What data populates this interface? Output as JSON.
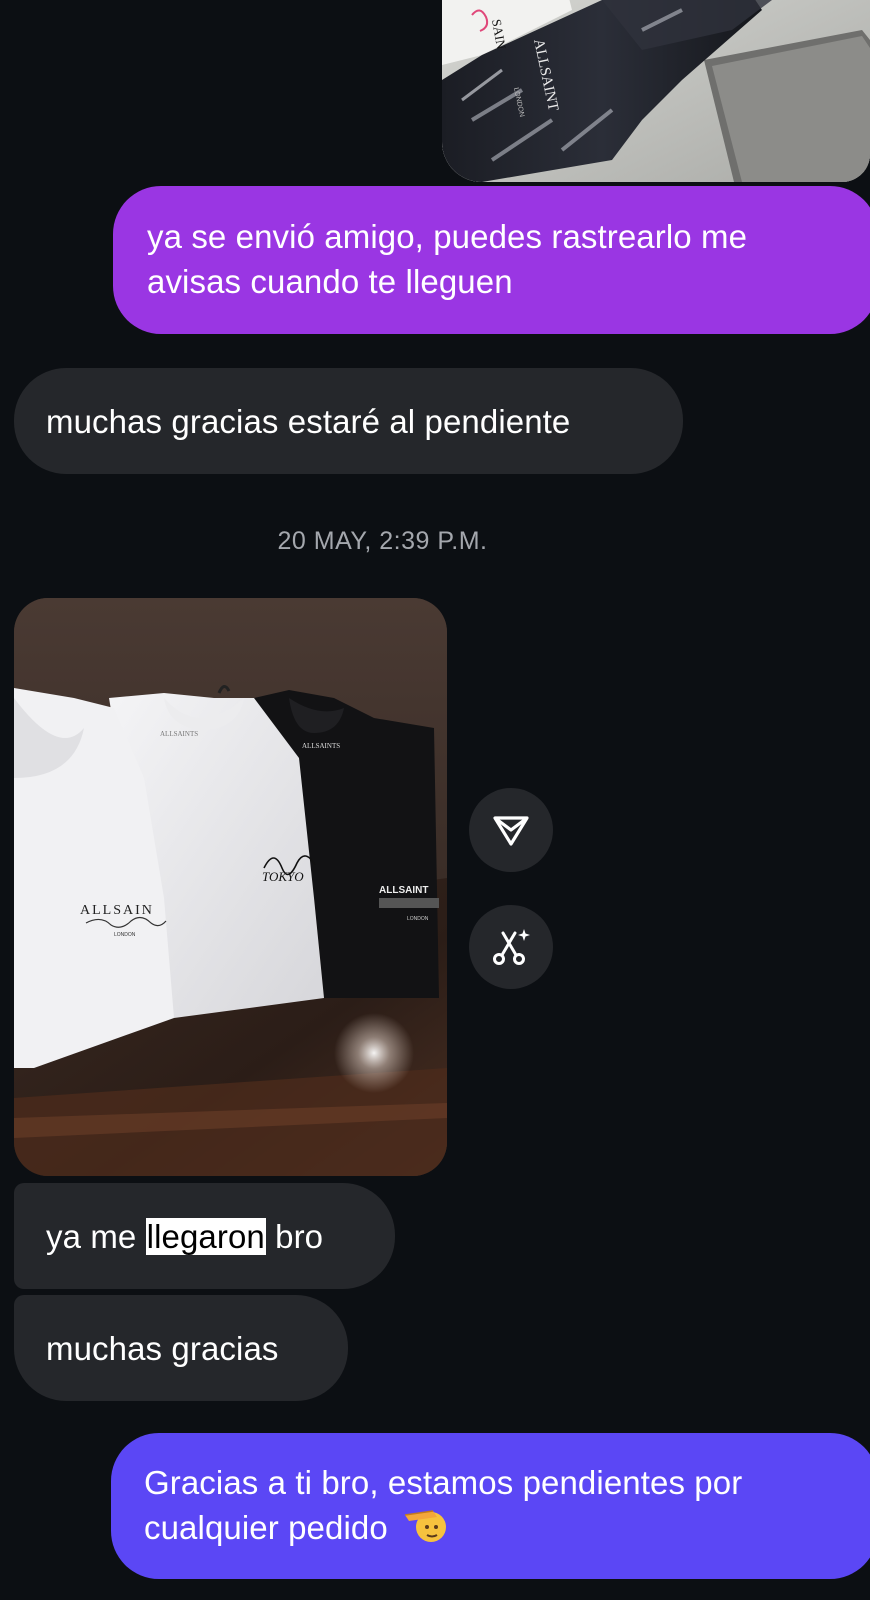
{
  "conversation": {
    "messages": [
      {
        "id": "m1",
        "side": "sent",
        "text": "ya se envió amigo, puedes rastrearlo me avisas cuando te lleguen"
      },
      {
        "id": "m2",
        "side": "received",
        "text": "muchas gracias estaré al pendiente"
      },
      {
        "id": "m3",
        "side": "received",
        "text_before": "ya me ",
        "text_highlight": "llegaron",
        "text_after": " bro"
      },
      {
        "id": "m4",
        "side": "received",
        "text": "muchas gracias"
      },
      {
        "id": "m5",
        "side": "sent",
        "text": "Gracias a ti bro, estamos pendientes por cualquier pedido"
      }
    ],
    "timestamp": "20 MAY, 2:39 P.M.",
    "photo_top": {
      "labels": [
        "SAIN",
        "ALLSAINT",
        "LONDON"
      ]
    },
    "photo_received": {
      "labels": [
        "ALLSAINTS",
        "ALLSAIN",
        "ALLSAINT",
        "TOKYO",
        "LONDON"
      ]
    }
  },
  "actions": {
    "share_icon": "paper-plane-icon",
    "remix_icon": "scissors-sparkle-icon"
  },
  "colors": {
    "background": "#0c0f13",
    "sent_purple": "#9a36e3",
    "sent_blue": "#5b47f5",
    "received": "#25272b",
    "timestamp": "#a4a7ad"
  }
}
